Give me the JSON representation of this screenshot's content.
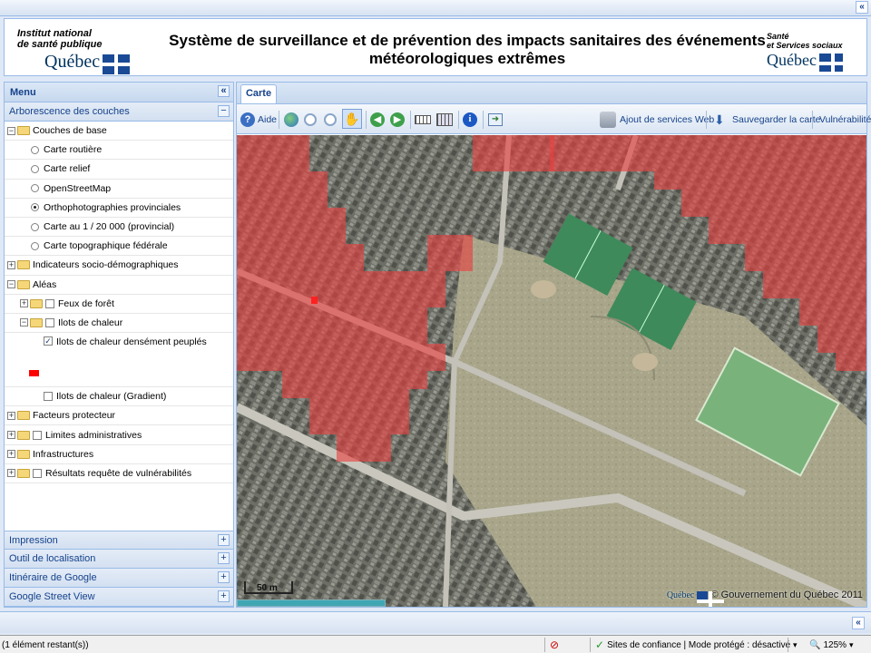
{
  "header": {
    "inspq_line1": "Institut national",
    "inspq_line2": "de santé publique",
    "inspq_logo_word": "Québec",
    "title_line1": "Système de surveillance et de prévention des impacts sanitaires des événements",
    "title_line2": "météorologiques extrêmes",
    "msss_line1": "Santé",
    "msss_line2": "et Services sociaux",
    "msss_logo_word": "Québec"
  },
  "top_strip": {
    "collapse_glyph": "«"
  },
  "left_panel": {
    "title": "Menu",
    "collapse_glyph": "«",
    "layers_header": "Arborescence des couches",
    "layers_toggle": "−",
    "tree": [
      {
        "label": "Couches de base"
      },
      {
        "label": "Carte routière"
      },
      {
        "label": "Carte relief"
      },
      {
        "label": "OpenStreetMap"
      },
      {
        "label": "Orthophotographies provinciales"
      },
      {
        "label": "Carte au 1 / 20 000 (provincial)"
      },
      {
        "label": "Carte topographique fédérale"
      },
      {
        "label": "Indicateurs socio-démographiques"
      },
      {
        "label": "Aléas"
      },
      {
        "label": "Feux de forêt"
      },
      {
        "label": "Ilots de chaleur"
      },
      {
        "label": "Ilots de chaleur densément peuplés"
      },
      {
        "label": "Ilots de chaleur (Gradient)"
      },
      {
        "label": "Facteurs protecteur"
      },
      {
        "label": "Limites administratives"
      },
      {
        "label": "Infrastructures"
      },
      {
        "label": "Résultats requête de vulnérabilités"
      }
    ],
    "legend_color": "#ff0000",
    "accordions": [
      {
        "label": "Impression",
        "toggle": "+"
      },
      {
        "label": "Outil de localisation",
        "toggle": "+"
      },
      {
        "label": "Itinéraire de Google",
        "toggle": "+"
      },
      {
        "label": "Google Street View",
        "toggle": "+"
      }
    ]
  },
  "map_panel": {
    "tab_label": "Carte",
    "toolbar": {
      "help_label": "Aide",
      "add_services_label": "Ajout de services Web",
      "save_map_label": "Sauvegarder la carte",
      "vulnerability_label": "Vulnérabilité"
    },
    "scale_label": "50 m",
    "copyright": "© Gouvernement du Québec 2011",
    "copyright_logo_word": "Québec",
    "loading_progress_percent": 100,
    "heat_island_color": "#e84040"
  },
  "bottom_strip": {
    "expand_glyph": "«"
  },
  "status_bar": {
    "remaining": "(1 élément restant(s))",
    "zone": "Sites de confiance | Mode protégé : désactivé",
    "zoom": "125%"
  }
}
